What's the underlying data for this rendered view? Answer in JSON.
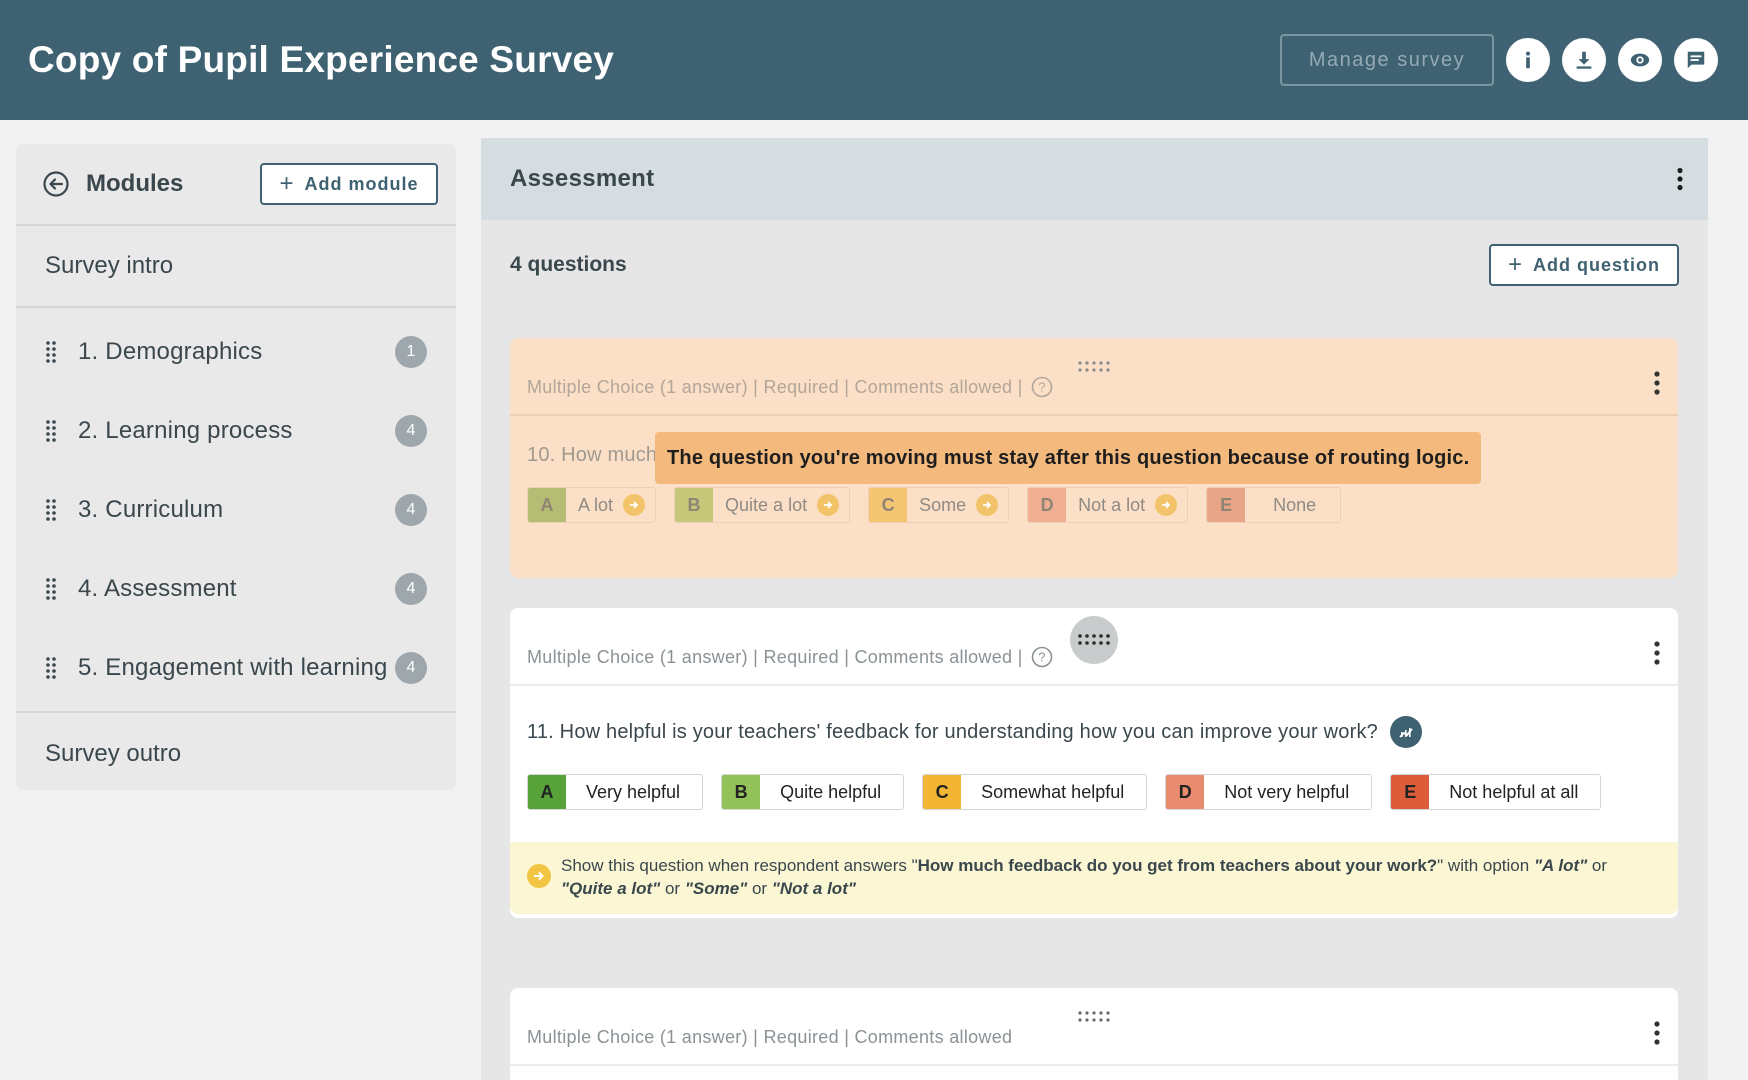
{
  "header": {
    "title": "Copy of Pupil Experience Survey",
    "manage_label": "Manage survey",
    "icons": [
      "info-icon",
      "download-icon",
      "eye-icon",
      "comment-icon"
    ]
  },
  "sidebar": {
    "title": "Modules",
    "add_module_label": "Add module",
    "intro_label": "Survey intro",
    "outro_label": "Survey outro",
    "items": [
      {
        "label": "1. Demographics",
        "count": "1"
      },
      {
        "label": "2. Learning process",
        "count": "4"
      },
      {
        "label": "3. Curriculum",
        "count": "4"
      },
      {
        "label": "4. Assessment",
        "count": "4"
      },
      {
        "label": "5. Engagement with learning",
        "count": "4"
      }
    ]
  },
  "main": {
    "title": "Assessment",
    "question_count": "4 questions",
    "add_question_label": "Add question",
    "questions": [
      {
        "meta": "Multiple Choice (1 answer) | Required | Comments allowed |",
        "text": "10. How much f",
        "tooltip": "The question you're moving must stay after this question because of routing logic.",
        "options": [
          {
            "letter": "A",
            "label": "A lot",
            "color": "#a8b565"
          },
          {
            "letter": "B",
            "label": "Quite a lot",
            "color": "#bcc26b"
          },
          {
            "letter": "C",
            "label": "Some",
            "color": "#f2c063"
          },
          {
            "letter": "D",
            "label": "Not a lot",
            "color": "#eea68a"
          },
          {
            "letter": "E",
            "label": "None",
            "color": "#e59a7c"
          }
        ]
      },
      {
        "meta": "Multiple Choice (1 answer) | Required | Comments allowed |",
        "text": "11. How helpful is your teachers' feedback for understanding how you can improve your work?",
        "options": [
          {
            "letter": "A",
            "label": "Very helpful",
            "color": "#57a33a"
          },
          {
            "letter": "B",
            "label": "Quite helpful",
            "color": "#93c25a"
          },
          {
            "letter": "C",
            "label": "Somewhat helpful",
            "color": "#f2b534"
          },
          {
            "letter": "D",
            "label": "Not very helpful",
            "color": "#e88b6f"
          },
          {
            "letter": "E",
            "label": "Not helpful at all",
            "color": "#dd5c3a"
          }
        ],
        "routing": {
          "prefix": "Show this question when respondent answers \"",
          "question": "How much feedback do you get from teachers about your work?",
          "mid": "\" with option ",
          "opt1": "\"A lot\"",
          "or1": " or ",
          "opt2": "\"Quite a lot\"",
          "or2": " or ",
          "opt3": "\"Some\"",
          "or3": " or ",
          "opt4": "\"Not a lot\""
        }
      },
      {
        "meta": "Multiple Choice (1 answer) | Required | Comments allowed"
      }
    ]
  },
  "colors": {
    "header_bg": "#3f6272",
    "tooltip_bg": "#f4b97d",
    "routing_bg": "#fbf6d3"
  }
}
